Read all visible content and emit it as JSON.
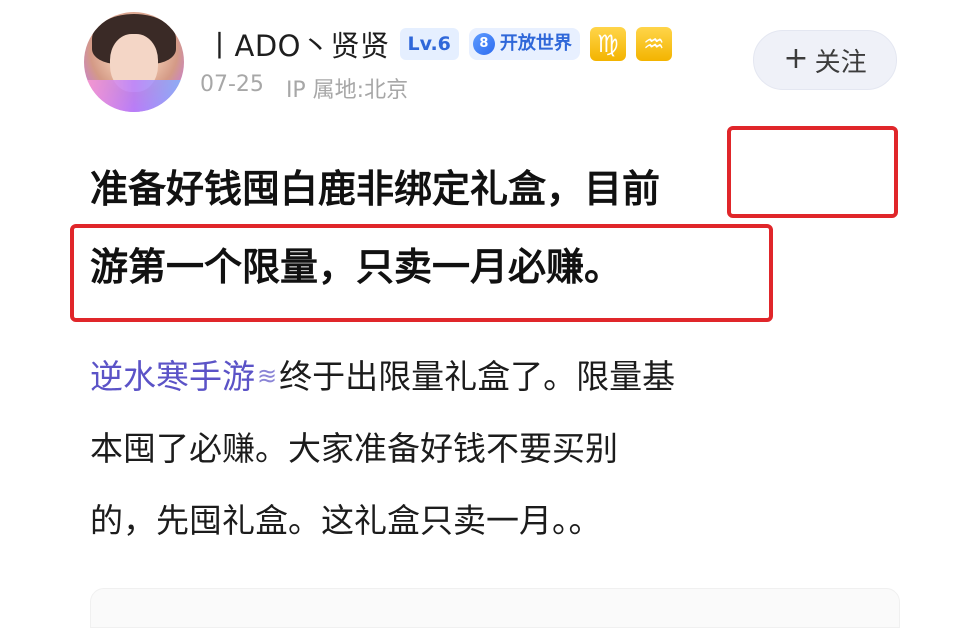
{
  "user": {
    "name": "丨ADO丶贤贤",
    "level": "Lv.6",
    "world_badge_number": "8",
    "world_badge_label": "开放世界",
    "zodiac_1": "♍",
    "zodiac_2": "♒",
    "date": "07-25",
    "ip_location": "IP 属地:北京"
  },
  "follow_button": {
    "plus": "+",
    "label": "关注"
  },
  "post": {
    "title_line_1": "准备好钱囤白鹿非绑定礼盒，目前",
    "title_line_2": "游第一个限量，只卖一月必赚。",
    "body": {
      "topic_link": "逆水寒手游",
      "topic_icon": "≋",
      "line_1_rest": "终于出限量礼盒了。限量基",
      "line_2": "本囤了必赚。大家准备好钱不要买别",
      "line_3": "的，先囤礼盒。这礼盒只卖一月。。"
    }
  },
  "colors": {
    "highlight": "#e0262a",
    "topic_link": "#5b53c7",
    "badge_blue": "#2f67d9"
  }
}
